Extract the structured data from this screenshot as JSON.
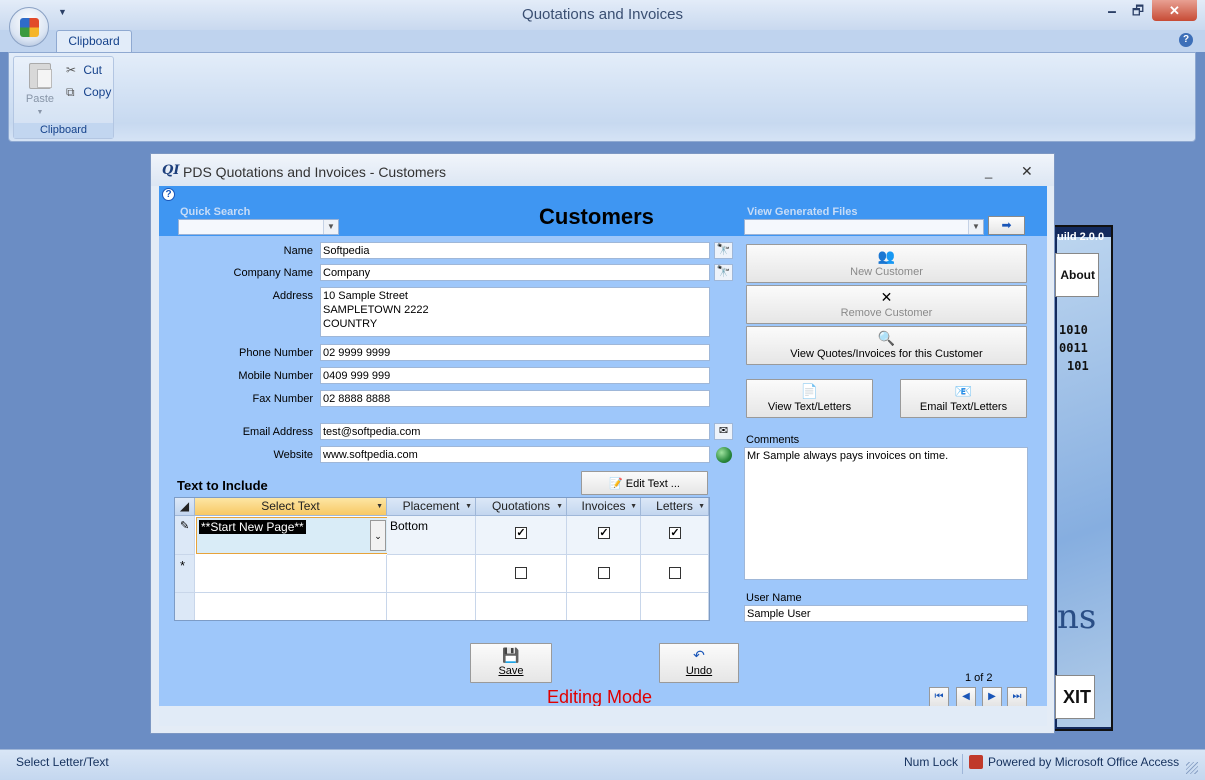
{
  "app": {
    "title": "Quotations and Invoices",
    "window_controls": {
      "minimize": "🗕",
      "maximize": "🗗",
      "close": "✕"
    }
  },
  "ribbon": {
    "tabs": [
      "Clipboard"
    ],
    "group_label": "Clipboard",
    "paste_label": "Paste",
    "cut_label": "Cut",
    "copy_label": "Copy"
  },
  "side_panel": {
    "build_text": "uild 2.0.0",
    "about_label": "About",
    "binary_lines": [
      "1010",
      "0011",
      "101"
    ],
    "partial_text": "ns",
    "exit_label": "XIT"
  },
  "dialog": {
    "logo": "QI",
    "title": "PDS Quotations and Invoices - Customers",
    "minimize": "_",
    "close": "✕"
  },
  "form": {
    "heading": "Customers",
    "quick_search_label": "Quick Search",
    "view_files_label": "View Generated Files",
    "go_label": "➡",
    "fields": {
      "name": {
        "label": "Name",
        "value": "Softpedia"
      },
      "company": {
        "label": "Company Name",
        "value": "Company"
      },
      "address": {
        "label": "Address",
        "value": "10 Sample Street\nSAMPLETOWN 2222\nCOUNTRY"
      },
      "phone": {
        "label": "Phone Number",
        "value": "02 9999 9999"
      },
      "mobile": {
        "label": "Mobile Number",
        "value": "0409 999 999"
      },
      "fax": {
        "label": "Fax Number",
        "value": "02 8888 8888"
      },
      "email": {
        "label": "Email Address",
        "value": "test@softpedia.com"
      },
      "website": {
        "label": "Website",
        "value": "www.softpedia.com"
      }
    },
    "buttons": {
      "new_customer": "New Customer",
      "remove_customer": "Remove Customer",
      "view_quotes": "View Quotes/Invoices for this Customer",
      "view_text": "View Text/Letters",
      "email_text": "Email Text/Letters",
      "edit_text": "Edit Text ...",
      "save": "Save",
      "undo": "Undo"
    },
    "text_section_label": "Text to Include",
    "grid": {
      "columns": [
        "Select Text",
        "Placement",
        "Quotations",
        "Invoices",
        "Letters"
      ],
      "rows": [
        {
          "select_text": "**Start New Page**",
          "placement": "Bottom",
          "quotations": true,
          "invoices": true,
          "letters": true
        }
      ],
      "new_row_marker": "*",
      "edit_marker": "✎"
    },
    "comments_label": "Comments",
    "comments_value": "Mr Sample always pays invoices on time.",
    "user_name_label": "User Name",
    "user_name_value": "Sample User",
    "mode_text": "Editing Mode",
    "page_count": "1 of 2",
    "nav": {
      "first": "⏮",
      "prev": "◀",
      "next": "▶",
      "last": "⏭"
    }
  },
  "statusbar": {
    "left_text": "Select Letter/Text",
    "num_lock": "Num Lock",
    "powered_by": "Powered by Microsoft Office Access"
  },
  "colors": {
    "header_band": "#3f96f2",
    "form_background": "#9ec7fa",
    "editing_mode": "#e00000",
    "ribbon_text": "#15428b"
  }
}
